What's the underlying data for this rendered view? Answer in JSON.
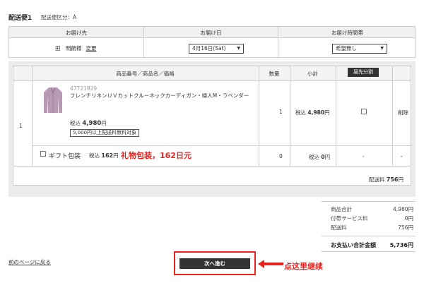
{
  "header": {
    "title": "配送便1",
    "subtitle": "配送便区分：A"
  },
  "delivery": {
    "headers": [
      "お届け先",
      "お届け日",
      "お届け時間帯"
    ],
    "recipient": "田　明朗様",
    "change_link": "変更",
    "date_value": "4月16日(Sat)",
    "time_value": "希望無し"
  },
  "items_table": {
    "headers": {
      "product": "商品番号／商品名／価格",
      "qty": "数量",
      "subtotal": "小計",
      "split": "届先分割"
    },
    "row_number": "1",
    "product_code": "47721829",
    "product_name": "フレンチリネンＵＶカットクルーネックカーディガン・婦人M・ラベンダー",
    "price_prefix": "税込",
    "price_value": "4,980",
    "price_unit": "円",
    "ship_tag": "5,000円以上配送料無料対象",
    "qty": "1",
    "subtotal_prefix": "税込",
    "subtotal_value": "4,980",
    "subtotal_unit": "円",
    "delete": "削除",
    "gift_label": "ギフト包装",
    "gift_price_prefix": "税込",
    "gift_price_value": "162",
    "gift_price_unit": "円",
    "gift_note": "礼物包装，162日元",
    "gift_qty": "0",
    "gift_subtotal_prefix": "税込",
    "gift_subtotal_value": "0",
    "gift_subtotal_unit": "円",
    "gift_split": "-",
    "gift_delete": "-",
    "shipping_label": "配送料",
    "shipping_value": "756",
    "shipping_unit": "円"
  },
  "totals": {
    "rows": [
      {
        "label": "商品合計",
        "value": "4,980円"
      },
      {
        "label": "付帯サービス料",
        "value": "0円"
      },
      {
        "label": "配送料",
        "value": "756円"
      }
    ],
    "grand_label": "お支払い合計金額",
    "grand_value": "5,736円"
  },
  "footer": {
    "back_link": "前のページに戻る",
    "next_button": "次へ進む",
    "annotation": "点这里继续"
  },
  "colors": {
    "annotation_red": "#e8231e",
    "button_dark": "#333333",
    "panel_gray": "#ececec",
    "cardigan_lavender": "#b89ab5"
  }
}
